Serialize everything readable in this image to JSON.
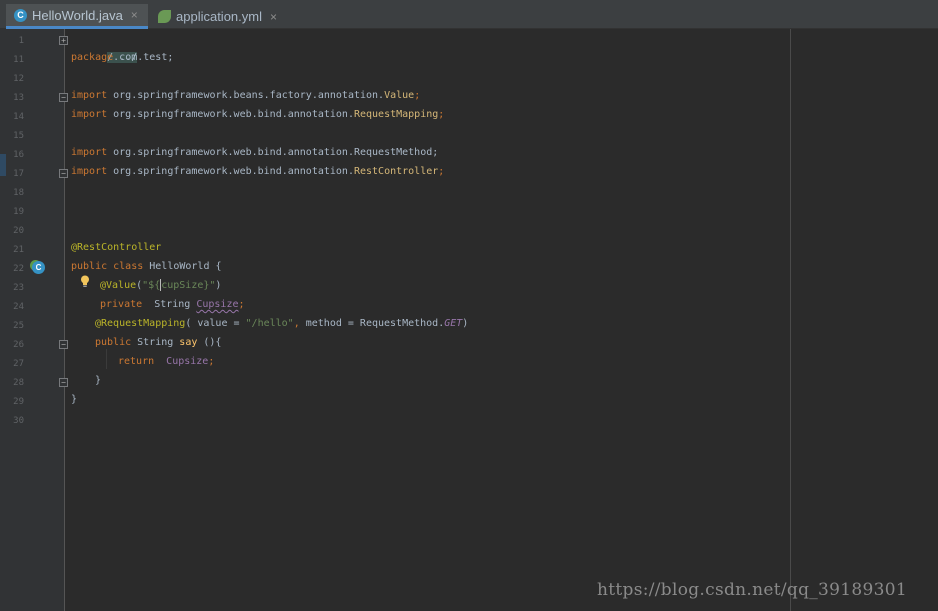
{
  "tabs": [
    {
      "label": "HelloWorld.java",
      "icon": "java-class-icon",
      "active": true
    },
    {
      "label": "application.yml",
      "icon": "spring-yml-icon",
      "active": false
    }
  ],
  "close_glyph": "×",
  "line_numbers": [
    "1",
    "11",
    "12",
    "13",
    "14",
    "15",
    "16",
    "17",
    "18",
    "19",
    "20",
    "21",
    "22",
    "23",
    "24",
    "25",
    "26",
    "27",
    "28",
    "29",
    "30"
  ],
  "code": {
    "l1": "/.../",
    "l11_kw": "package",
    "l11_rest": " com.test;",
    "import_kw": "import",
    "l13_pkg": " org.springframework.beans.factory.annotation.",
    "l13_cls": "Value",
    "l14_pkg": " org.springframework.web.bind.annotation.",
    "l14_cls": "RequestMapping",
    "l16_pkg": " org.springframework.web.bind.annotation.RequestMethod;",
    "l17_pkg": " org.springframework.web.bind.annotation.",
    "l17_cls": "RestController",
    "semicolon": ";",
    "l21": "@RestController",
    "l22_kw": "public class",
    "l22_rest": " HelloWorld {",
    "l23_ann": "@Value",
    "l23_open": "(",
    "l23_str1": "\"${",
    "l23_str2": "cupSize}\"",
    "l23_close": ")",
    "l24_kw": "private",
    "l24_type": "  String ",
    "l24_fld": "Cupsize",
    "l25_ann": "@RequestMapping",
    "l25_open": "( ",
    "l25_attr1": "value",
    "l25_eq": " = ",
    "l25_str": "\"/hello\"",
    "l25_comma": ", ",
    "l25_attr2": "method",
    "l25_rest": " = RequestMethod.",
    "l25_static": "GET",
    "l25_close": ")",
    "l26_kw": "public",
    "l26_type": " String ",
    "l26_fn": "say",
    "l26_rest": " (){",
    "l27_kw": "return",
    "l27_sp": "  ",
    "l27_fld": "Cupsize",
    "l28": "}",
    "l29": "}"
  },
  "gutter_icon": "spring-bean-class-icon",
  "watermark": "https://blog.csdn.net/qq_39189301",
  "colors": {
    "background": "#2b2b2b",
    "gutter": "#313335",
    "keyword": "#cc7832",
    "annotation": "#bbb529",
    "string": "#6a8759",
    "field": "#9876aa",
    "method": "#ffc66d",
    "line_number": "#606366"
  }
}
